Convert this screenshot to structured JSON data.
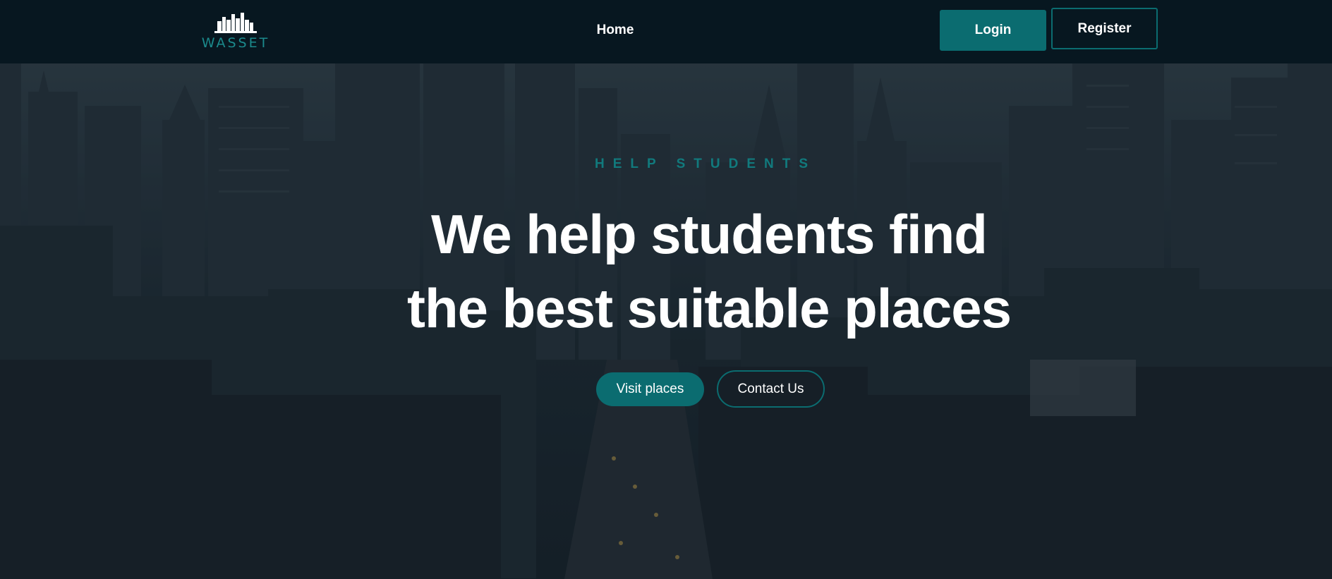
{
  "navbar": {
    "logo_text": "WASSET",
    "home_label": "Home",
    "login_label": "Login",
    "register_label": "Register"
  },
  "hero": {
    "eyebrow": "HELP STUDENTS",
    "headline_line1": "We help students find",
    "headline_line2": "the best suitable places",
    "visit_label": "Visit places",
    "contact_label": "Contact Us"
  },
  "colors": {
    "accent": "#0b6c70",
    "navbar_bg": "#071720",
    "text": "#ffffff"
  },
  "icons": {
    "logo": "city-skyline-icon"
  }
}
